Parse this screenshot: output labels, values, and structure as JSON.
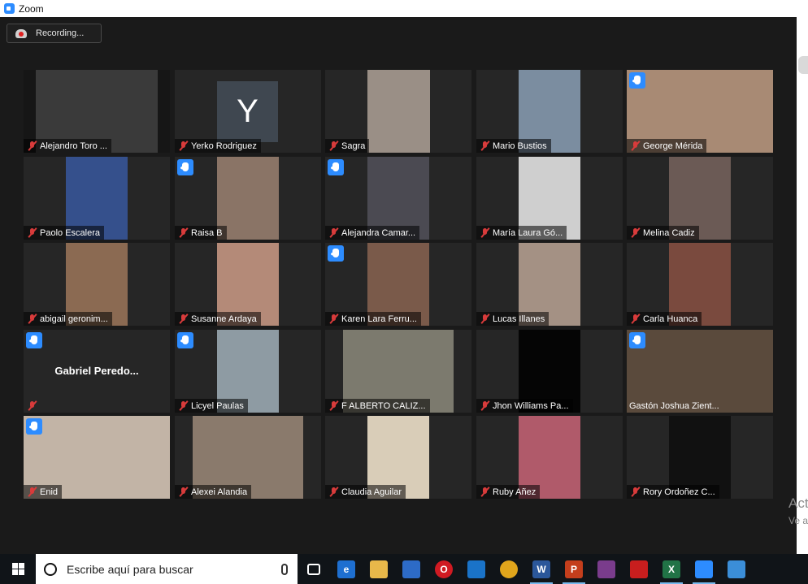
{
  "window": {
    "title": "Zoom"
  },
  "recording": {
    "label": "Recording..."
  },
  "participants": [
    {
      "name": "Alejandro Toro ...",
      "hand": false,
      "bg": "#161616",
      "video": "#3a3a3a",
      "vl": 15,
      "vw": 150
    },
    {
      "name": "Yerko Rodriguez",
      "hand": false,
      "initial": "Y"
    },
    {
      "name": "Sagra",
      "hand": false,
      "bg": "#262626",
      "video": "#9a8f86",
      "vl": 52,
      "vw": 77
    },
    {
      "name": "Mario Bustios",
      "hand": false,
      "bg": "#262626",
      "video": "#7b8da0",
      "vl": 52,
      "vw": 76
    },
    {
      "name": "George Mérida",
      "hand": true,
      "bg": "#262626",
      "video": "#a88a74",
      "vl": 0,
      "vw": 180
    },
    {
      "name": "Paolo Escalera",
      "hand": false,
      "bg": "#262626",
      "video": "#35508c",
      "vl": 52,
      "vw": 76
    },
    {
      "name": "Raisa B",
      "hand": true,
      "bg": "#262626",
      "video": "#8a7466",
      "vl": 52,
      "vw": 76
    },
    {
      "name": "Alejandra Camar...",
      "hand": true,
      "bg": "#262626",
      "video": "#4b4a52",
      "vl": 52,
      "vw": 76
    },
    {
      "name": "María Laura Gó...",
      "hand": false,
      "bg": "#262626",
      "video": "#cfcfcf",
      "vl": 52,
      "vw": 76
    },
    {
      "name": "Melina Cadiz",
      "hand": false,
      "bg": "#262626",
      "video": "#6b5a55",
      "vl": 52,
      "vw": 76
    },
    {
      "name": "abigail geronim...",
      "hand": false,
      "bg": "#262626",
      "video": "#8b6a52",
      "vl": 52,
      "vw": 76
    },
    {
      "name": "Susanne Ardaya",
      "hand": false,
      "bg": "#262626",
      "video": "#b48a78",
      "vl": 52,
      "vw": 76
    },
    {
      "name": "Karen Lara Ferru...",
      "hand": true,
      "bg": "#262626",
      "video": "#7a5a4a",
      "vl": 52,
      "vw": 76
    },
    {
      "name": "Lucas Illanes",
      "hand": false,
      "bg": "#262626",
      "video": "#a49184",
      "vl": 52,
      "vw": 76
    },
    {
      "name": "Carla Huanca",
      "hand": false,
      "bg": "#262626",
      "video": "#7a4a3e",
      "vl": 52,
      "vw": 76
    },
    {
      "name": "Gabriel  Peredo...",
      "hand": true,
      "big": true
    },
    {
      "name": "Licyel Paulas",
      "hand": true,
      "bg": "#262626",
      "video": "#8e9ba3",
      "vl": 52,
      "vw": 76
    },
    {
      "name": "F ALBERTO CALIZ...",
      "hand": false,
      "bg": "#262626",
      "video": "#7c7a6e",
      "vl": 22,
      "vw": 136
    },
    {
      "name": "Jhon Williams Pa...",
      "hand": false,
      "bg": "#262626",
      "video": "#050505",
      "vl": 52,
      "vw": 76
    },
    {
      "name": "Gastón Joshua Zient...",
      "hand": true,
      "bg": "#262626",
      "video": "#5a4a3c",
      "vl": 0,
      "vw": 180,
      "active": true,
      "plain": true
    },
    {
      "name": "Enid",
      "hand": true,
      "bg": "#262626",
      "video": "#c2b4a6",
      "vl": 0,
      "vw": 180
    },
    {
      "name": "Alexei Alandia",
      "hand": false,
      "bg": "#262626",
      "video": "#8a7a6c",
      "vl": 22,
      "vw": 136
    },
    {
      "name": "Claudia Aguilar",
      "hand": false,
      "bg": "#262626",
      "video": "#d9cdb8",
      "vl": 52,
      "vw": 76
    },
    {
      "name": "Ruby Añez",
      "hand": false,
      "bg": "#262626",
      "video": "#b05a6a",
      "vl": 52,
      "vw": 76
    },
    {
      "name": "Rory Ordoñez C...",
      "hand": false,
      "bg": "#262626",
      "video": "#111111",
      "vl": 52,
      "vw": 76
    }
  ],
  "watermark": {
    "line1": "Act",
    "line2": "Ve a"
  },
  "taskbar": {
    "search_placeholder": "Escribe aquí para buscar",
    "apps": [
      {
        "name": "task-view-icon",
        "label": "",
        "color": "#101418",
        "open": false
      },
      {
        "name": "edge-icon",
        "label": "e",
        "color": "#1e6fd0",
        "open": false
      },
      {
        "name": "file-explorer-icon",
        "label": "",
        "color": "#e8b84a",
        "open": false
      },
      {
        "name": "store-icon",
        "label": "",
        "color": "#2d6bc7",
        "open": false
      },
      {
        "name": "opera-icon",
        "label": "O",
        "color": "#d01a22",
        "open": false
      },
      {
        "name": "mail-icon",
        "label": "",
        "color": "#1a73c8",
        "open": false
      },
      {
        "name": "chrome-icon",
        "label": "",
        "color": "#e0a51c",
        "open": false
      },
      {
        "name": "word-icon",
        "label": "W",
        "color": "#2b579a",
        "open": true
      },
      {
        "name": "powerpoint-icon",
        "label": "P",
        "color": "#c43e1c",
        "open": true
      },
      {
        "name": "winrar-icon",
        "label": "",
        "color": "#7a3c8c",
        "open": false
      },
      {
        "name": "acrobat-icon",
        "label": "",
        "color": "#c81e1e",
        "open": false
      },
      {
        "name": "excel-icon",
        "label": "X",
        "color": "#217346",
        "open": true
      },
      {
        "name": "zoom-app-icon",
        "label": "",
        "color": "#2d8cff",
        "open": true
      },
      {
        "name": "photos-icon",
        "label": "",
        "color": "#3b8ed8",
        "open": false
      }
    ]
  }
}
